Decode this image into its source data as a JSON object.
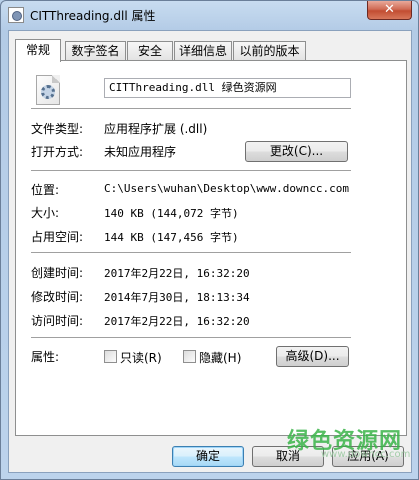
{
  "window": {
    "title": "CITThreading.dll 属性",
    "close_label": "✕"
  },
  "tabs": [
    {
      "label": "常规",
      "active": true
    },
    {
      "label": "数字签名",
      "active": false
    },
    {
      "label": "安全",
      "active": false
    },
    {
      "label": "详细信息",
      "active": false
    },
    {
      "label": "以前的版本",
      "active": false
    }
  ],
  "general": {
    "file_name": "CITThreading.dll 绿色资源网",
    "file_icon": "dll-file-icon",
    "file_type_label": "文件类型:",
    "file_type_value": "应用程序扩展 (.dll)",
    "opens_with_label": "打开方式:",
    "opens_with_value": "未知应用程序",
    "change_button": "更改(C)...",
    "location_label": "位置:",
    "location_value": "C:\\Users\\wuhan\\Desktop\\www.downcc.com",
    "size_label": "大小:",
    "size_value": "140 KB (144,072 字节)",
    "size_on_disk_label": "占用空间:",
    "size_on_disk_value": "144 KB (147,456 字节)",
    "created_label": "创建时间:",
    "created_value": "2017年2月22日, 16:32:20",
    "modified_label": "修改时间:",
    "modified_value": "2014年7月30日, 18:13:34",
    "accessed_label": "访问时间:",
    "accessed_value": "2017年2月22日, 16:32:20",
    "attributes_label": "属性:",
    "readonly_label": "只读(R)",
    "hidden_label": "隐藏(H)",
    "advanced_button": "高级(D)..."
  },
  "footer": {
    "ok_button": "确定",
    "cancel_button": "取消",
    "apply_button": "应用(A)"
  },
  "watermark": {
    "text": "绿色资源网",
    "url": "www.downcc.com"
  }
}
